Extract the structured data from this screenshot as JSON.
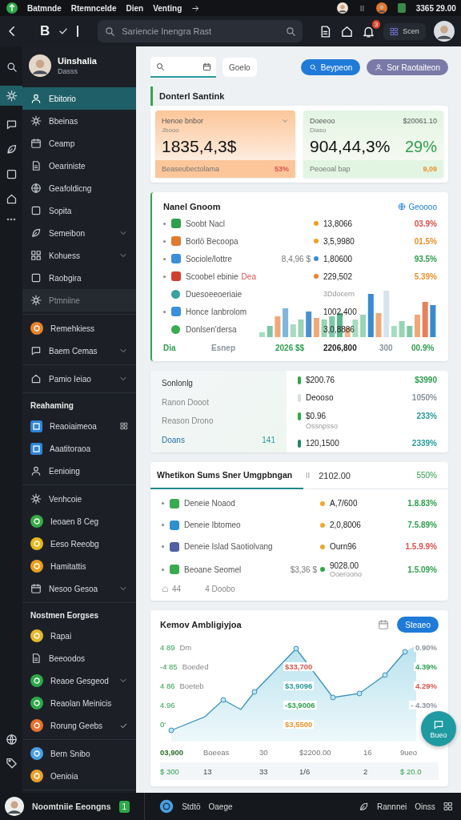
{
  "status_bar": {
    "apps": [
      "Batmnde",
      "Rtemncelde",
      "Dien",
      "Venting"
    ],
    "clock": "3365 29.00"
  },
  "header": {
    "logo": "B",
    "search": {
      "placeholder": "Sariencie Inengra Rast"
    },
    "notifications": "3",
    "user_chip": "Scen"
  },
  "sidebar": {
    "profile": {
      "name": "Uinshalia",
      "role": "Dasss"
    },
    "groups": [
      {
        "items": [
          {
            "label": "Ebitorio",
            "kind": "nav",
            "selected": true,
            "disabled": false,
            "expandable": false
          },
          {
            "label": "Bbeinas",
            "kind": "nav",
            "selected": false,
            "disabled": false,
            "expandable": false
          },
          {
            "label": "Ceamp",
            "kind": "nav",
            "selected": false,
            "disabled": false,
            "expandable": false
          },
          {
            "label": "Oeariniste",
            "kind": "nav",
            "selected": false,
            "disabled": false,
            "expandable": false
          },
          {
            "label": "Geafoldicng",
            "kind": "nav",
            "selected": false,
            "disabled": false,
            "expandable": false
          },
          {
            "label": "Sopita",
            "kind": "nav",
            "selected": false,
            "disabled": false,
            "expandable": false
          },
          {
            "label": "Semeibon",
            "kind": "nav",
            "selected": false,
            "disabled": false,
            "expandable": true
          },
          {
            "label": "Kohuess",
            "kind": "nav",
            "selected": false,
            "disabled": false,
            "expandable": true
          },
          {
            "label": "Raobgira",
            "kind": "nav",
            "selected": false,
            "disabled": false,
            "expandable": false
          },
          {
            "label": "Ptmniine",
            "kind": "nav",
            "selected": false,
            "disabled": true,
            "expandable": false
          }
        ]
      },
      {
        "items": [
          {
            "label": "Remehkiess",
            "kind": "coin",
            "color": "#e8822e",
            "selected": false,
            "expandable": false
          },
          {
            "label": "Baem Cemas",
            "kind": "nav",
            "selected": false,
            "expandable": true
          }
        ]
      },
      {
        "items": [
          {
            "label": "Pamio Ieiao",
            "kind": "nav",
            "selected": false,
            "expandable": true
          }
        ]
      },
      {
        "heading": "Reahaming",
        "items": [
          {
            "label": "Reaoiaimeoa",
            "kind": "tile",
            "color": "#2f86d6",
            "selected": false,
            "pinned": true
          },
          {
            "label": "Aaatitoraoa",
            "kind": "tile",
            "color": "#2f86d6",
            "selected": false,
            "pinned": false
          },
          {
            "label": "Eenioing",
            "kind": "nav",
            "selected": false,
            "pinned": false
          }
        ]
      },
      {
        "items": [
          {
            "label": "Venhcoie",
            "kind": "nav",
            "selected": false,
            "expandable": false
          },
          {
            "label": "Ieoaen 8 Ceg",
            "kind": "coin",
            "color": "#3aaa4a",
            "selected": false,
            "expandable": false
          },
          {
            "label": "Eeso Reeobg",
            "kind": "coin",
            "color": "#e6b820",
            "selected": false,
            "expandable": false
          },
          {
            "label": "Hamitattis",
            "kind": "coin",
            "color": "#e8a020",
            "selected": false,
            "expandable": false
          },
          {
            "label": "Nesoo Gesoa",
            "kind": "nav",
            "selected": false,
            "expandable": true
          }
        ]
      },
      {
        "heading": "Nostmen Eorgses",
        "items": [
          {
            "label": "Rapai",
            "kind": "coin",
            "color": "#e6b830",
            "selected": false,
            "expandable": false,
            "checked": false
          },
          {
            "label": "Beeoodos",
            "kind": "nav",
            "selected": false,
            "expandable": false,
            "checked": false
          },
          {
            "label": "Reaoe Gesgeod",
            "kind": "coin",
            "color": "#2ea84a",
            "selected": false,
            "expandable": true,
            "checked": false
          },
          {
            "label": "Reaolan Meinicis",
            "kind": "coin",
            "color": "#2ea84a",
            "selected": false,
            "expandable": false,
            "checked": false
          },
          {
            "label": "Rorung Geebs",
            "kind": "coin",
            "color": "#e8702e",
            "selected": false,
            "expandable": false,
            "checked": true
          }
        ]
      },
      {
        "items": [
          {
            "label": "Bern Snibo",
            "kind": "coin",
            "color": "#4aa0e0",
            "selected": false
          },
          {
            "label": "Oenioia",
            "kind": "coin",
            "color": "#e8a030",
            "selected": false
          }
        ]
      }
    ]
  },
  "toolbar": {
    "filter": "Goelo",
    "buttons": [
      {
        "label": "Beypeon",
        "kind": "primary"
      },
      {
        "label": "Sor Raotaiteon",
        "kind": "secondary"
      }
    ]
  },
  "summary": {
    "title": "Donterl Santink",
    "cards": [
      {
        "color": "#fcc69a",
        "label": "Henoe bnbor",
        "sublabel": "Jbooo",
        "value": "1835,4,3$",
        "footer": "Beaseubectolama",
        "footer_value": {
          "text": "53%",
          "color": "#d9534f"
        }
      },
      {
        "color": "#e2f5e3",
        "label": "Doeeoo",
        "corner": "$20061.10",
        "sublabel": "Diaso",
        "value": "904,44,3%",
        "change": "29%",
        "footer": "Peoeoal bap",
        "footer_value": {
          "text": "9,09",
          "color": "#e8912d"
        }
      }
    ]
  },
  "market": {
    "title": "Nanel Gnoom",
    "link": "Geoooo",
    "rows": [
      {
        "kind": "main",
        "name": "Soobt Nacl",
        "icon": {
          "color": "#2e9e4f"
        },
        "value": "13,8066",
        "dot": {
          "color": "#f0a020"
        },
        "change": {
          "text": "03.9%",
          "color": "#d9534f"
        }
      },
      {
        "kind": "main",
        "name": "Borlö Becoopa",
        "icon": {
          "color": "#e07a30"
        },
        "value": "3,5,9980",
        "dot": {
          "color": "#f0a020"
        },
        "change": {
          "text": "01.5%",
          "color": "#e8912d"
        }
      },
      {
        "kind": "main",
        "name": "Sociole/lottre",
        "icon": {
          "color": "#3a8fd8"
        },
        "extra": "8,4,96 $",
        "value": "1,80600",
        "dot": {
          "color": "#3a8fd8"
        },
        "change": {
          "text": "93.5%",
          "color": "#2e9e4f"
        }
      },
      {
        "kind": "main",
        "name": "Scoobel ebinie",
        "tag": "Dea",
        "icon": {
          "color": "#d04030"
        },
        "value": "229,502",
        "dot": {
          "color": "#f08030"
        },
        "change": {
          "text": "5.39%",
          "color": "#e8912d"
        }
      },
      {
        "kind": "sub",
        "name": "Duesoeeoeriaie",
        "icon": {
          "color": "#3aa0a0"
        },
        "note": "3Ddocern"
      },
      {
        "kind": "main",
        "name": "Honce Ianbrolom",
        "icon": {
          "color": "#3a8fd8"
        },
        "value": "1002,400"
      },
      {
        "kind": "sub",
        "name": "Donlsen'dersa",
        "icon": {
          "color": "#3aaa50"
        },
        "value": "3,0,8886"
      }
    ],
    "footer": [
      {
        "text": "Dia",
        "color": "#2e9e4f"
      },
      {
        "text": "Esnep",
        "color": "#8a949e"
      },
      {
        "text": "2026 $$",
        "color": "#2e9e4f"
      },
      {
        "text": "2206,800",
        "color": "#222222"
      },
      {
        "text": "300",
        "color": "#8a949e"
      },
      {
        "text": "00.9%",
        "color": "#2e9e4f"
      }
    ]
  },
  "balance": {
    "left": [
      {
        "text": "Sonlonlg",
        "kind": "title"
      },
      {
        "text": "Ranon Dooot",
        "kind": "label"
      },
      {
        "text": "Reason Drono",
        "kind": "label"
      },
      {
        "text": "Doans",
        "kind": "link",
        "count": "141"
      }
    ],
    "right": [
      {
        "value": "$200.76",
        "change": {
          "text": "$3990",
          "color": "#2e9e4f"
        },
        "color": "#2ea84a"
      },
      {
        "value": "Deooso",
        "change": {
          "text": "1050%",
          "color": "#8a949e"
        },
        "color": "#d8dde2"
      },
      {
        "value": "$0.96",
        "note": "Ossnpsso",
        "change": {
          "text": "233%",
          "color": "#2a9a9a"
        },
        "color": "#2ea84a"
      },
      {
        "value": "120,1500",
        "change": {
          "text": "2339%",
          "color": "#2a9a9a"
        },
        "color": "#1f8a5a"
      }
    ]
  },
  "holdings": {
    "tab": {
      "label": "Whetikon Sums Sner Umgpbngan",
      "selected": true
    },
    "header_value": "2102.00",
    "header_change": "550%",
    "rows": [
      {
        "name": "Deneie Noaod",
        "icon": {
          "color": "#3aaa50"
        },
        "value": "A,7/600",
        "dot": {
          "color": "#f0a830"
        },
        "change": {
          "text": "1.8.83%",
          "color": "#2e9e4f"
        }
      },
      {
        "name": "Deneie Ibtomeo",
        "icon": {
          "color": "#2f90d0"
        },
        "value": "2,0,8006",
        "dot": {
          "color": "#f0a830"
        },
        "change": {
          "text": "7.5.89%",
          "color": "#2e9e4f"
        }
      },
      {
        "name": "Deneie Islad Saotiolvang",
        "icon": {
          "color": "#5060a0"
        },
        "value": "Ourn96",
        "dot": {
          "color": "#f0a830"
        },
        "change": {
          "text": "1.5.9.9%",
          "color": "#d9534f"
        }
      },
      {
        "name": "Beoane Seomel",
        "icon": {
          "color": "#3aaa50"
        },
        "extra": "$3,36 $",
        "value": "9028.00",
        "note": "Ooeroono",
        "dot": {
          "color": "#2ea84a"
        },
        "change": {
          "text": "1.5.09%",
          "color": "#2e9e4f"
        }
      }
    ],
    "footer": [
      "44",
      "4 Doobo"
    ]
  },
  "trend": {
    "title": "Kemov Ambligiyjoa",
    "button": "Steaeo",
    "left": [
      {
        "value": "4 89",
        "label": "Dm"
      },
      {
        "value": "-4 85",
        "label": "Boeded"
      },
      {
        "value": "4 86",
        "label": "Boeteb"
      },
      {
        "value": "4.96"
      },
      {
        "value": "0'"
      }
    ],
    "center": [
      {
        "text": "$33,700",
        "color": "#d9534f"
      },
      {
        "text": "$3,9096",
        "color": "#2a9a9a"
      },
      {
        "text": "-$3,9006",
        "color": "#2e9e4f"
      },
      {
        "text": "$3,5500",
        "color": "#e8912d"
      }
    ],
    "right": [
      {
        "text": "0.90%",
        "color": "#8a949e"
      },
      {
        "text": "4.39%",
        "color": "#2e9e4f"
      },
      {
        "text": "4.29%",
        "color": "#d9534f"
      },
      {
        "text": "- 4.30%",
        "color": "#8a949e"
      }
    ],
    "axis": [
      "03,900",
      "Boeeas",
      "30",
      "$2200.00",
      "16",
      "9ueo"
    ],
    "totals": [
      "$ 300",
      "13",
      "33",
      "1/6",
      "2",
      "$ 20.0"
    ]
  },
  "fab": "Bueo",
  "footer_bar": {
    "user": "Noomtniie Eeongns",
    "badge": "1",
    "items": [
      "Stdtö",
      "Oaege"
    ],
    "right": [
      "Rannnei",
      "Oinss"
    ]
  }
}
